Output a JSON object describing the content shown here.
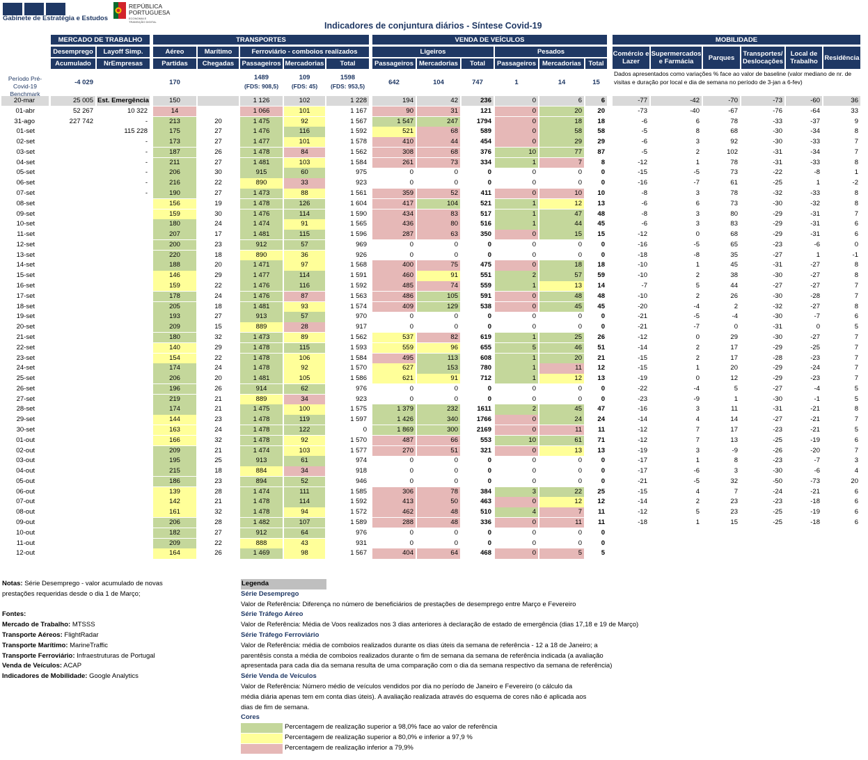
{
  "header": {
    "org_name": "Gabinete de Estratégia e Estudos",
    "republic_line1": "REPÚBLICA",
    "republic_line2": "PORTUGUESA",
    "ministry_line1": "ECONOMIA E",
    "ministry_line2": "TRANSIÇÃO DIGITAL",
    "title": "Indicadores de conjuntura diários - Síntese Covid-19"
  },
  "colors": {
    "header_blue": "#1F3864",
    "green": "#C4D79B",
    "yellow": "#FFFF99",
    "pink": "#E6B8B7",
    "gray": "#D9D9D9"
  },
  "groups": {
    "mercado": "MERCADO DE TRABALHO",
    "transportes": "TRANSPORTES",
    "venda": "VENDA DE VEÍCULOS",
    "mobilidade": "MOBILIDADE"
  },
  "subheaders": {
    "desemprego": "Desemprego",
    "layoff": "Layoff Simp.",
    "aereo": "Aéreo",
    "maritimo": "Marítimo",
    "ferroviario": "Ferroviário - comboios realizados",
    "ligeiros": "Ligeiros",
    "pesados": "Pesados",
    "comercio": "Comércio e Lazer",
    "supermercados": "Supermercados e Farmácia",
    "parques": "Parques",
    "transportes_desl": "Transportes/ Deslocações",
    "local_trabalho": "Local de Trabalho",
    "residencia": "Residência"
  },
  "subheaders2": {
    "acumulado": "Acumulado",
    "nrempresas": "NrEmpresas",
    "partidas": "Partidas",
    "chegadas": "Chegadas",
    "passageiros": "Passageiros",
    "mercadorias": "Mercadorias",
    "total": "Total"
  },
  "benchmark": {
    "label": "Período Pré-Covid-19 Benchmark",
    "desemprego": "-4 029",
    "aereo": "170",
    "ferro_pass": "1489",
    "ferro_pass_fds": "(FDS: 908,5)",
    "ferro_merc": "109",
    "ferro_merc_fds": "(FDS: 45)",
    "ferro_total": "1598",
    "ferro_total_fds": "(FDS: 953,5)",
    "lig_pass": "642",
    "lig_merc": "104",
    "lig_total": "747",
    "pes_pass": "1",
    "pes_merc": "14",
    "pes_total": "15",
    "mobility_note": "Dados apresentados como variações % face ao valor de baseline (valor mediano de nr. de visitas e duração por local e dia de semana no período de 3-jan a 6-fev)"
  },
  "rows": [
    [
      "20-mar",
      "25 005",
      "Est. Emergência",
      "150",
      "",
      "1 126",
      "102",
      "1 228",
      "194",
      "42",
      "236",
      "0",
      "6",
      "6",
      "-77",
      "-42",
      "-70",
      "-73",
      "-60",
      "36"
    ],
    [
      "01-abr",
      "52 267",
      "10 322",
      "14",
      "",
      "1 066",
      "101",
      "1 167",
      "90",
      "31",
      "121",
      "0",
      "20",
      "20",
      "-73",
      "-40",
      "-67",
      "-76",
      "-64",
      "33"
    ],
    [
      "31-ago",
      "227 742",
      "-",
      "213",
      "20",
      "1 475",
      "92",
      "1 567",
      "1 547",
      "247",
      "1794",
      "0",
      "18",
      "18",
      "-6",
      "6",
      "78",
      "-33",
      "-37",
      "9"
    ],
    [
      "01-set",
      "",
      "115 228",
      "175",
      "27",
      "1 476",
      "116",
      "1 592",
      "521",
      "68",
      "589",
      "0",
      "58",
      "58",
      "-5",
      "8",
      "68",
      "-30",
      "-34",
      "8"
    ],
    [
      "02-set",
      "",
      "-",
      "173",
      "27",
      "1 477",
      "101",
      "1 578",
      "410",
      "44",
      "454",
      "0",
      "29",
      "29",
      "-6",
      "3",
      "92",
      "-30",
      "-33",
      "7"
    ],
    [
      "03-set",
      "",
      "-",
      "187",
      "26",
      "1 478",
      "84",
      "1 562",
      "308",
      "68",
      "376",
      "10",
      "77",
      "87",
      "-5",
      "2",
      "102",
      "-31",
      "-34",
      "7"
    ],
    [
      "04-set",
      "",
      "-",
      "211",
      "27",
      "1 481",
      "103",
      "1 584",
      "261",
      "73",
      "334",
      "1",
      "7",
      "8",
      "-12",
      "1",
      "78",
      "-31",
      "-33",
      "8"
    ],
    [
      "05-set",
      "",
      "-",
      "206",
      "30",
      "915",
      "60",
      "975",
      "0",
      "0",
      "0",
      "0",
      "0",
      "0",
      "-15",
      "-5",
      "73",
      "-22",
      "-8",
      "1"
    ],
    [
      "06-set",
      "",
      "-",
      "216",
      "22",
      "890",
      "33",
      "923",
      "0",
      "0",
      "0",
      "0",
      "0",
      "0",
      "-16",
      "-7",
      "61",
      "-25",
      "1",
      "-2"
    ],
    [
      "07-set",
      "",
      "-",
      "190",
      "27",
      "1 473",
      "88",
      "1 561",
      "359",
      "52",
      "411",
      "0",
      "10",
      "10",
      "-8",
      "3",
      "78",
      "-32",
      "-33",
      "8"
    ],
    [
      "08-set",
      "",
      "",
      "156",
      "19",
      "1 478",
      "126",
      "1 604",
      "417",
      "104",
      "521",
      "1",
      "12",
      "13",
      "-6",
      "6",
      "73",
      "-30",
      "-32",
      "8"
    ],
    [
      "09-set",
      "",
      "",
      "159",
      "30",
      "1 476",
      "114",
      "1 590",
      "434",
      "83",
      "517",
      "1",
      "47",
      "48",
      "-8",
      "3",
      "80",
      "-29",
      "-31",
      "7"
    ],
    [
      "10-set",
      "",
      "",
      "180",
      "24",
      "1 474",
      "91",
      "1 565",
      "436",
      "80",
      "516",
      "1",
      "44",
      "45",
      "-6",
      "3",
      "83",
      "-29",
      "-31",
      "6"
    ],
    [
      "11-set",
      "",
      "",
      "207",
      "17",
      "1 481",
      "115",
      "1 596",
      "287",
      "63",
      "350",
      "0",
      "15",
      "15",
      "-12",
      "0",
      "68",
      "-29",
      "-31",
      "6"
    ],
    [
      "12-set",
      "",
      "",
      "200",
      "23",
      "912",
      "57",
      "969",
      "0",
      "0",
      "0",
      "0",
      "0",
      "0",
      "-16",
      "-5",
      "65",
      "-23",
      "-6",
      "0"
    ],
    [
      "13-set",
      "",
      "",
      "220",
      "18",
      "890",
      "36",
      "926",
      "0",
      "0",
      "0",
      "0",
      "0",
      "0",
      "-18",
      "-8",
      "35",
      "-27",
      "1",
      "-1"
    ],
    [
      "14-set",
      "",
      "",
      "188",
      "20",
      "1 471",
      "97",
      "1 568",
      "400",
      "75",
      "475",
      "0",
      "18",
      "18",
      "-10",
      "1",
      "45",
      "-31",
      "-27",
      "8"
    ],
    [
      "15-set",
      "",
      "",
      "146",
      "29",
      "1 477",
      "114",
      "1 591",
      "460",
      "91",
      "551",
      "2",
      "57",
      "59",
      "-10",
      "2",
      "38",
      "-30",
      "-27",
      "8"
    ],
    [
      "16-set",
      "",
      "",
      "159",
      "22",
      "1 476",
      "116",
      "1 592",
      "485",
      "74",
      "559",
      "1",
      "13",
      "14",
      "-7",
      "5",
      "44",
      "-27",
      "-27",
      "7"
    ],
    [
      "17-set",
      "",
      "",
      "178",
      "24",
      "1 476",
      "87",
      "1 563",
      "486",
      "105",
      "591",
      "0",
      "48",
      "48",
      "-10",
      "2",
      "26",
      "-30",
      "-28",
      "7"
    ],
    [
      "18-set",
      "",
      "",
      "205",
      "18",
      "1 481",
      "93",
      "1 574",
      "409",
      "129",
      "538",
      "0",
      "45",
      "45",
      "-20",
      "-4",
      "2",
      "-32",
      "-27",
      "8"
    ],
    [
      "19-set",
      "",
      "",
      "193",
      "27",
      "913",
      "57",
      "970",
      "0",
      "0",
      "0",
      "0",
      "0",
      "0",
      "-21",
      "-5",
      "-4",
      "-30",
      "-7",
      "6"
    ],
    [
      "20-set",
      "",
      "",
      "209",
      "15",
      "889",
      "28",
      "917",
      "0",
      "0",
      "0",
      "0",
      "0",
      "0",
      "-21",
      "-7",
      "0",
      "-31",
      "0",
      "5"
    ],
    [
      "21-set",
      "",
      "",
      "180",
      "32",
      "1 473",
      "89",
      "1 562",
      "537",
      "82",
      "619",
      "1",
      "25",
      "26",
      "-12",
      "0",
      "29",
      "-30",
      "-27",
      "7"
    ],
    [
      "22-set",
      "",
      "",
      "140",
      "29",
      "1 478",
      "115",
      "1 593",
      "559",
      "96",
      "655",
      "5",
      "46",
      "51",
      "-14",
      "2",
      "17",
      "-29",
      "-25",
      "7"
    ],
    [
      "23-set",
      "",
      "",
      "154",
      "22",
      "1 478",
      "106",
      "1 584",
      "495",
      "113",
      "608",
      "1",
      "20",
      "21",
      "-15",
      "2",
      "17",
      "-28",
      "-23",
      "7"
    ],
    [
      "24-set",
      "",
      "",
      "174",
      "24",
      "1 478",
      "92",
      "1 570",
      "627",
      "153",
      "780",
      "1",
      "11",
      "12",
      "-15",
      "1",
      "20",
      "-29",
      "-24",
      "7"
    ],
    [
      "25-set",
      "",
      "",
      "206",
      "20",
      "1 481",
      "105",
      "1 586",
      "621",
      "91",
      "712",
      "1",
      "12",
      "13",
      "-19",
      "0",
      "12",
      "-29",
      "-23",
      "7"
    ],
    [
      "26-set",
      "",
      "",
      "196",
      "26",
      "914",
      "62",
      "976",
      "0",
      "0",
      "0",
      "0",
      "0",
      "0",
      "-22",
      "-4",
      "5",
      "-27",
      "-4",
      "5"
    ],
    [
      "27-set",
      "",
      "",
      "219",
      "21",
      "889",
      "34",
      "923",
      "0",
      "0",
      "0",
      "0",
      "0",
      "0",
      "-23",
      "-9",
      "1",
      "-30",
      "-1",
      "5"
    ],
    [
      "28-set",
      "",
      "",
      "174",
      "21",
      "1 475",
      "100",
      "1 575",
      "1 379",
      "232",
      "1611",
      "2",
      "45",
      "47",
      "-16",
      "3",
      "11",
      "-31",
      "-21",
      "8"
    ],
    [
      "29-set",
      "",
      "",
      "144",
      "23",
      "1 478",
      "119",
      "1 597",
      "1 426",
      "340",
      "1766",
      "0",
      "24",
      "24",
      "-14",
      "4",
      "14",
      "-27",
      "-21",
      "7"
    ],
    [
      "30-set",
      "",
      "",
      "163",
      "24",
      "1 478",
      "122",
      "0",
      "1 869",
      "300",
      "2169",
      "0",
      "11",
      "11",
      "-12",
      "7",
      "17",
      "-23",
      "-21",
      "5"
    ],
    [
      "01-out",
      "",
      "",
      "166",
      "32",
      "1 478",
      "92",
      "1 570",
      "487",
      "66",
      "553",
      "10",
      "61",
      "71",
      "-12",
      "7",
      "13",
      "-25",
      "-19",
      "6"
    ],
    [
      "02-out",
      "",
      "",
      "209",
      "21",
      "1 474",
      "103",
      "1 577",
      "270",
      "51",
      "321",
      "0",
      "13",
      "13",
      "-19",
      "3",
      "-9",
      "-26",
      "-20",
      "7"
    ],
    [
      "03-out",
      "",
      "",
      "195",
      "25",
      "913",
      "61",
      "974",
      "0",
      "0",
      "0",
      "0",
      "0",
      "0",
      "-17",
      "1",
      "8",
      "-23",
      "-7",
      "3"
    ],
    [
      "04-out",
      "",
      "",
      "215",
      "18",
      "884",
      "34",
      "918",
      "0",
      "0",
      "0",
      "0",
      "0",
      "0",
      "-17",
      "-6",
      "3",
      "-30",
      "-6",
      "4"
    ],
    [
      "05-out",
      "",
      "",
      "186",
      "23",
      "894",
      "52",
      "946",
      "0",
      "0",
      "0",
      "0",
      "0",
      "0",
      "-21",
      "-5",
      "32",
      "-50",
      "-73",
      "20"
    ],
    [
      "06-out",
      "",
      "",
      "139",
      "28",
      "1 474",
      "111",
      "1 585",
      "306",
      "78",
      "384",
      "3",
      "22",
      "25",
      "-15",
      "4",
      "7",
      "-24",
      "-21",
      "6"
    ],
    [
      "07-out",
      "",
      "",
      "142",
      "21",
      "1 478",
      "114",
      "1 592",
      "413",
      "50",
      "463",
      "0",
      "12",
      "12",
      "-14",
      "2",
      "23",
      "-23",
      "-18",
      "6"
    ],
    [
      "08-out",
      "",
      "",
      "161",
      "32",
      "1 478",
      "94",
      "1 572",
      "462",
      "48",
      "510",
      "4",
      "7",
      "11",
      "-12",
      "5",
      "23",
      "-25",
      "-19",
      "6"
    ],
    [
      "09-out",
      "",
      "",
      "206",
      "28",
      "1 482",
      "107",
      "1 589",
      "288",
      "48",
      "336",
      "0",
      "11",
      "11",
      "-18",
      "1",
      "15",
      "-25",
      "-18",
      "6"
    ],
    [
      "10-out",
      "",
      "",
      "182",
      "27",
      "912",
      "64",
      "976",
      "0",
      "0",
      "0",
      "0",
      "0",
      "0",
      "",
      "",
      "",
      "",
      "",
      ""
    ],
    [
      "11-out",
      "",
      "",
      "209",
      "22",
      "888",
      "43",
      "931",
      "0",
      "0",
      "0",
      "0",
      "0",
      "0",
      "",
      "",
      "",
      "",
      "",
      ""
    ],
    [
      "12-out",
      "",
      "",
      "164",
      "26",
      "1 469",
      "98",
      "1 567",
      "404",
      "64",
      "468",
      "0",
      "5",
      "5",
      "",
      "",
      "",
      "",
      "",
      ""
    ]
  ],
  "notes": {
    "notas_label": "Notas:",
    "notas_text1": " Série Desemprego - valor acumulado de novas",
    "notas_text2": "prestações requeridas desde o dia 1 de Março;",
    "fontes": "Fontes:",
    "src": [
      {
        "k": "Mercado de Trabalho:",
        "v": " MTSSS"
      },
      {
        "k": "Transporte Aéreos:",
        "v": " FlightRadar"
      },
      {
        "k": "Transporte Marítimo:",
        "v": " MarineTraffic"
      },
      {
        "k": "Transporte Ferroviário:",
        "v": " Infraestruturas de Portugal"
      },
      {
        "k": "Venda de Veículos:",
        "v": " ACAP"
      },
      {
        "k": "Indicadores de Mobilidade:",
        "v": " Google Analytics"
      }
    ]
  },
  "legend": {
    "title": "Legenda",
    "s1": "Série Desemprego",
    "s1_t1": "Valor de Referência: Diferença no número de beneficiários de prestações de desemprego entre Março e Fevereiro",
    "s2": "Série Tráfego Aéreo",
    "s2_t1": "Valor de Referência: Média de Voos realizados nos 3 dias anteriores à declaração de estado de emergência (dias 17,18 e 19 de Março)",
    "s3": "Série Tráfego Ferroviário",
    "s3_t1": "Valor de Referência: média de comboios realizados durante os dias úteis da semana de referência - 12 a 18 de Janeiro; a",
    "s3_t2": "parentêsis consta a média de comboios realizados durante o fim de semana da semana de referência indicada (a avaliação",
    "s3_t3": "apresentada para cada dia da semana resulta de uma comparação com o dia da semana respectivo da semana de referência)",
    "s4": "Série Venda de Veículos",
    "s4_t1": "Valor de Referência: Número médio de veículos vendidos por dia no período de Janeiro e Fevereiro (o cálculo da",
    "s4_t2": "média diária apenas tem em conta dias úteis). A avaliação realizada através do esquema de cores não é aplicada aos",
    "s4_t3": "dias de fim de semana.",
    "cores": "Cores",
    "c_green": "Percentagem de realização superior a 98,0% face ao valor de referência",
    "c_yellow": "Percentagem de realização superior a 80,0% e inferior a 97,9 %",
    "c_pink": "Percentagem de realização inferior a 79,9%"
  }
}
